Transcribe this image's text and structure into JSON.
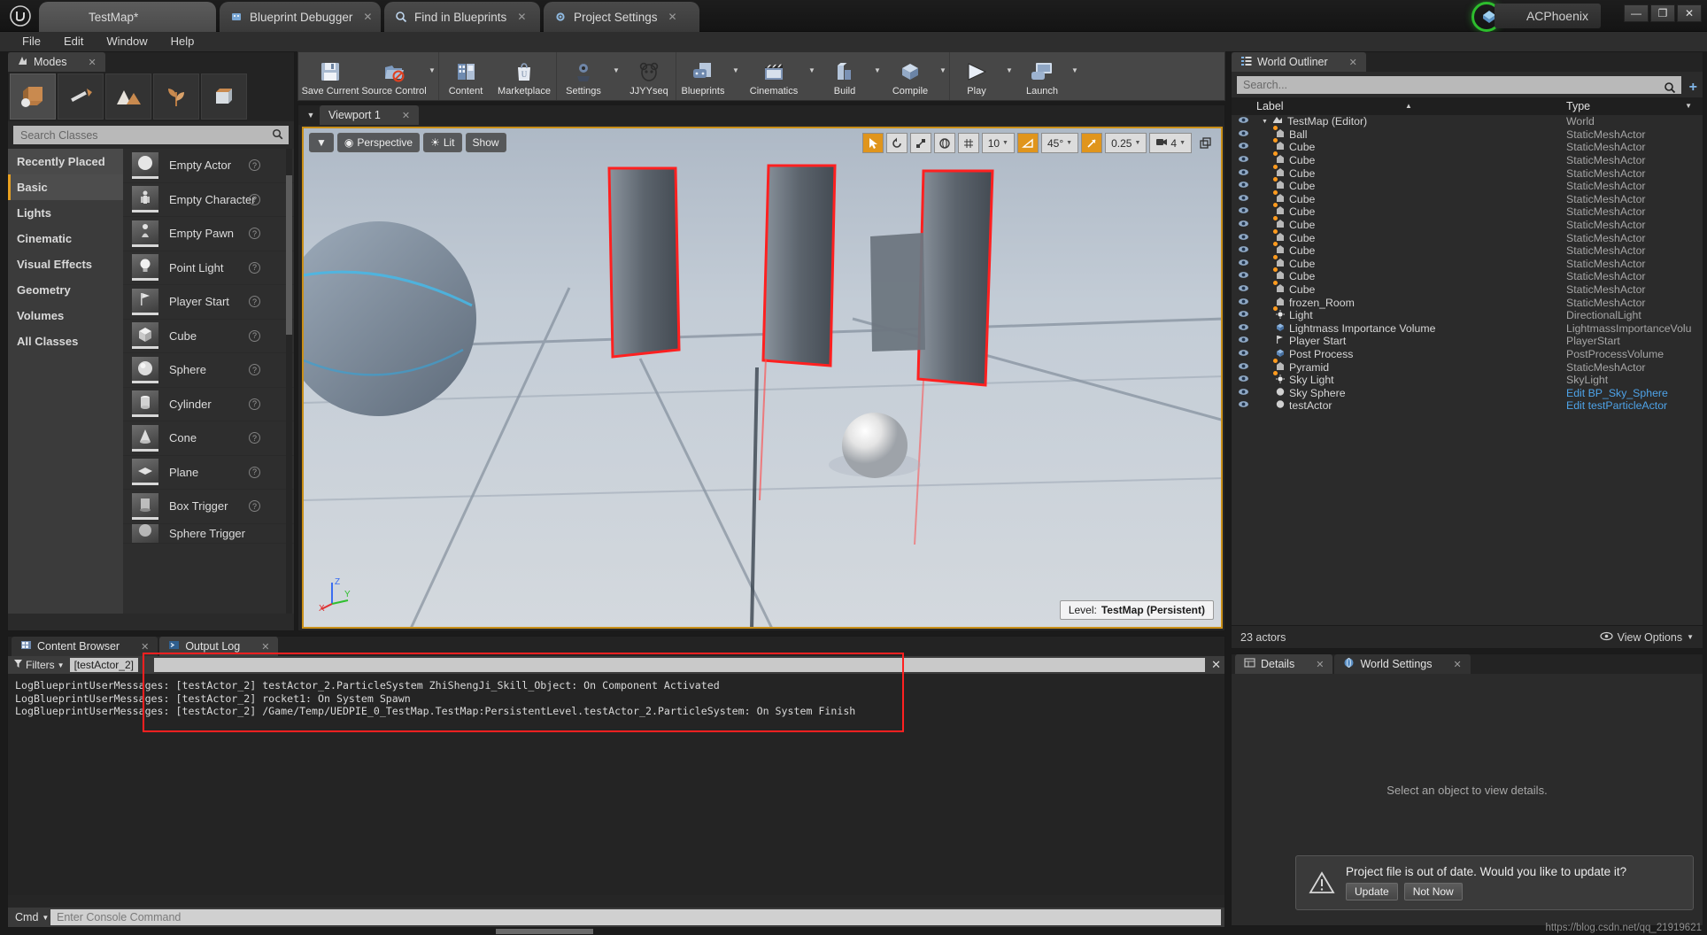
{
  "titlebar": {
    "app_icon": "unreal-logo",
    "tabs": [
      {
        "label": "TestMap*",
        "icon": "",
        "active": true,
        "closable": false
      },
      {
        "label": "Blueprint Debugger",
        "icon": "debugger-icon",
        "active": false,
        "closable": true
      },
      {
        "label": "Find in Blueprints",
        "icon": "search-icon",
        "active": false,
        "closable": true
      },
      {
        "label": "Project Settings",
        "icon": "gear-icon",
        "active": false,
        "closable": true
      }
    ],
    "brand": "ACPhoenix",
    "window_buttons": [
      "—",
      "❐",
      "✕"
    ]
  },
  "menubar": {
    "items": [
      "File",
      "Edit",
      "Window",
      "Help"
    ]
  },
  "modes": {
    "tab_label": "Modes",
    "tab_close": "✕",
    "mode_icons": [
      {
        "name": "place-mode",
        "glyph": "📦",
        "selected": true
      },
      {
        "name": "paint-mode",
        "glyph": "🖌",
        "selected": false
      },
      {
        "name": "landscape-mode",
        "glyph": "⛰",
        "selected": false
      },
      {
        "name": "foliage-mode",
        "glyph": "🌿",
        "selected": false
      },
      {
        "name": "geometry-edit-mode",
        "glyph": "📦",
        "selected": false
      }
    ],
    "search_placeholder": "Search Classes",
    "categories": [
      {
        "label": "Recently Placed",
        "selected": false,
        "top": true
      },
      {
        "label": "Basic",
        "selected": true,
        "top": false
      },
      {
        "label": "Lights",
        "selected": false,
        "top": false
      },
      {
        "label": "Cinematic",
        "selected": false,
        "top": false
      },
      {
        "label": "Visual Effects",
        "selected": false,
        "top": false
      },
      {
        "label": "Geometry",
        "selected": false,
        "top": false
      },
      {
        "label": "Volumes",
        "selected": false,
        "top": false
      },
      {
        "label": "All Classes",
        "selected": false,
        "top": false
      }
    ],
    "items": [
      {
        "label": "Empty Actor",
        "glyph": "●"
      },
      {
        "label": "Empty Character",
        "glyph": "👤"
      },
      {
        "label": "Empty Pawn",
        "glyph": "♟"
      },
      {
        "label": "Point Light",
        "glyph": "💡"
      },
      {
        "label": "Player Start",
        "glyph": "⚑"
      },
      {
        "label": "Cube",
        "glyph": "■"
      },
      {
        "label": "Sphere",
        "glyph": "●"
      },
      {
        "label": "Cylinder",
        "glyph": "▮"
      },
      {
        "label": "Cone",
        "glyph": "▲"
      },
      {
        "label": "Plane",
        "glyph": "◆"
      },
      {
        "label": "Box Trigger",
        "glyph": "□"
      },
      {
        "label": "Sphere Trigger",
        "glyph": "○"
      }
    ],
    "help_glyph": "?"
  },
  "toolbar": {
    "groups": [
      [
        {
          "label": "Save Current",
          "icon": "save-icon",
          "glyph": "💾",
          "arrow": false
        },
        {
          "label": "Source Control",
          "icon": "source-control-icon",
          "glyph": "📁",
          "arrow": true
        }
      ],
      [
        {
          "label": "Content",
          "icon": "content-icon",
          "glyph": "🪟",
          "arrow": false
        },
        {
          "label": "Marketplace",
          "icon": "marketplace-icon",
          "glyph": "🛍",
          "arrow": false
        }
      ],
      [
        {
          "label": "Settings",
          "icon": "settings-gear-icon",
          "glyph": "⚙",
          "arrow": true
        },
        {
          "label": "JJYYseq",
          "icon": "blueprint-panda-icon",
          "glyph": "◎",
          "arrow": false
        }
      ],
      [
        {
          "label": "Blueprints",
          "icon": "blueprints-icon",
          "glyph": "🎮",
          "arrow": true
        },
        {
          "label": "Cinematics",
          "icon": "cinematics-icon",
          "glyph": "🎬",
          "arrow": true
        },
        {
          "label": "Build",
          "icon": "build-icon",
          "glyph": "🏢",
          "arrow": true
        },
        {
          "label": "Compile",
          "icon": "compile-icon",
          "glyph": "🧱",
          "arrow": true
        }
      ],
      [
        {
          "label": "Play",
          "icon": "play-icon",
          "glyph": "▶",
          "arrow": true
        },
        {
          "label": "Launch",
          "icon": "launch-icon",
          "glyph": "🖥",
          "arrow": true
        }
      ]
    ]
  },
  "viewport": {
    "tab_label": "Viewport 1",
    "tab_close": "✕",
    "perspective": "Perspective",
    "lit": "Lit",
    "show": "Show",
    "grid_value": "10",
    "angle_value": "45°",
    "scale_value": "0.25",
    "camera_value": "4",
    "level_label": "Level:",
    "level_name": "TestMap (Persistent)",
    "axis": {
      "x": "X",
      "y": "Y",
      "z": "Z"
    }
  },
  "outliner": {
    "tab_label": "World Outliner",
    "tab_close": "✕",
    "search_placeholder": "Search...",
    "columns": [
      "Label",
      "Type"
    ],
    "rows": [
      {
        "label": "TestMap (Editor)",
        "type": "World",
        "indent": 0,
        "icon": "world-icon",
        "dot": false,
        "link": false
      },
      {
        "label": "Ball",
        "type": "StaticMeshActor",
        "indent": 1,
        "icon": "mesh-icon",
        "dot": true,
        "link": false
      },
      {
        "label": "Cube",
        "type": "StaticMeshActor",
        "indent": 1,
        "icon": "mesh-icon",
        "dot": true,
        "link": false
      },
      {
        "label": "Cube",
        "type": "StaticMeshActor",
        "indent": 1,
        "icon": "mesh-icon",
        "dot": true,
        "link": false
      },
      {
        "label": "Cube",
        "type": "StaticMeshActor",
        "indent": 1,
        "icon": "mesh-icon",
        "dot": true,
        "link": false
      },
      {
        "label": "Cube",
        "type": "StaticMeshActor",
        "indent": 1,
        "icon": "mesh-icon",
        "dot": true,
        "link": false
      },
      {
        "label": "Cube",
        "type": "StaticMeshActor",
        "indent": 1,
        "icon": "mesh-icon",
        "dot": true,
        "link": false
      },
      {
        "label": "Cube",
        "type": "StaticMeshActor",
        "indent": 1,
        "icon": "mesh-icon",
        "dot": true,
        "link": false
      },
      {
        "label": "Cube",
        "type": "StaticMeshActor",
        "indent": 1,
        "icon": "mesh-icon",
        "dot": true,
        "link": false
      },
      {
        "label": "Cube",
        "type": "StaticMeshActor",
        "indent": 1,
        "icon": "mesh-icon",
        "dot": true,
        "link": false
      },
      {
        "label": "Cube",
        "type": "StaticMeshActor",
        "indent": 1,
        "icon": "mesh-icon",
        "dot": true,
        "link": false
      },
      {
        "label": "Cube",
        "type": "StaticMeshActor",
        "indent": 1,
        "icon": "mesh-icon",
        "dot": true,
        "link": false
      },
      {
        "label": "Cube",
        "type": "StaticMeshActor",
        "indent": 1,
        "icon": "mesh-icon",
        "dot": true,
        "link": false
      },
      {
        "label": "Cube",
        "type": "StaticMeshActor",
        "indent": 1,
        "icon": "mesh-icon",
        "dot": true,
        "link": false
      },
      {
        "label": "frozen_Room",
        "type": "StaticMeshActor",
        "indent": 1,
        "icon": "mesh-icon",
        "dot": false,
        "link": false
      },
      {
        "label": "Light",
        "type": "DirectionalLight",
        "indent": 1,
        "icon": "light-icon",
        "dot": true,
        "link": false
      },
      {
        "label": "Lightmass Importance Volume",
        "type": "LightmassImportanceVolu",
        "indent": 1,
        "icon": "volume-icon",
        "dot": false,
        "link": false
      },
      {
        "label": "Player Start",
        "type": "PlayerStart",
        "indent": 1,
        "icon": "playerstart-icon",
        "dot": false,
        "link": false
      },
      {
        "label": "Post Process",
        "type": "PostProcessVolume",
        "indent": 1,
        "icon": "volume-icon",
        "dot": false,
        "link": false
      },
      {
        "label": "Pyramid",
        "type": "StaticMeshActor",
        "indent": 1,
        "icon": "mesh-icon",
        "dot": true,
        "link": false
      },
      {
        "label": "Sky Light",
        "type": "SkyLight",
        "indent": 1,
        "icon": "light-icon",
        "dot": true,
        "link": false
      },
      {
        "label": "Sky Sphere",
        "type": "Edit BP_Sky_Sphere",
        "indent": 1,
        "icon": "bp-icon",
        "dot": false,
        "link": true
      },
      {
        "label": "testActor",
        "type": "Edit testParticleActor",
        "indent": 1,
        "icon": "bp-icon",
        "dot": false,
        "link": true
      }
    ],
    "status_count": "23 actors",
    "view_options": "View Options"
  },
  "details": {
    "tabs": [
      {
        "label": "Details",
        "icon": "details-icon",
        "active": true,
        "closable": true
      },
      {
        "label": "World Settings",
        "icon": "world-settings-icon",
        "active": false,
        "closable": true
      }
    ],
    "empty_message": "Select an object to view details."
  },
  "log": {
    "tabs": [
      {
        "label": "Content Browser",
        "icon": "content-browser-icon",
        "active": false,
        "closable": true
      },
      {
        "label": "Output Log",
        "icon": "output-log-icon",
        "active": true,
        "closable": true
      }
    ],
    "filters_label": "Filters",
    "filter_chip": "[testActor_2]",
    "filter_value": "",
    "close_glyph": "✕",
    "lines": [
      "LogBlueprintUserMessages: [testActor_2] testActor_2.ParticleSystem ZhiShengJi_Skill_Object: On Component Activated",
      "LogBlueprintUserMessages: [testActor_2] rocket1: On System Spawn",
      "LogBlueprintUserMessages: [testActor_2] /Game/Temp/UEDPIE_0_TestMap.TestMap:PersistentLevel.testActor_2.ParticleSystem: On System Finish"
    ],
    "cmd_label": "Cmd",
    "cmd_placeholder": "Enter Console Command"
  },
  "notification": {
    "message": "Project file is out of date. Would you like to update it?",
    "update_label": "Update",
    "notnow_label": "Not Now",
    "warn_glyph": "⚠"
  },
  "watermark": "https://blog.csdn.net/qq_21919621",
  "colors": {
    "accent_amber": "#e0951c",
    "link_blue": "#4ea3e8",
    "highlight_red": "#ff2020",
    "green_ring": "#2dbd2d"
  }
}
